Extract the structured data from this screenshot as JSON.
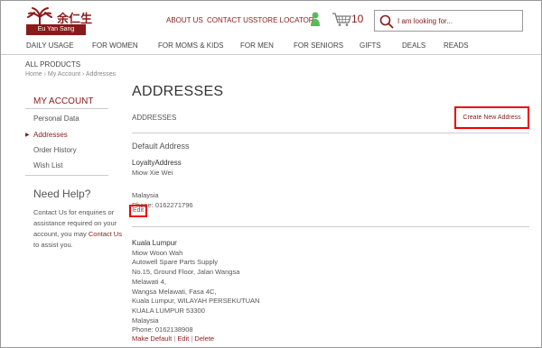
{
  "brand": {
    "chinese_name": "余仁生",
    "english_name": "Eu Yan Sang",
    "accent_color": "#8b1a1a"
  },
  "top_links": [
    "ABOUT US",
    "CONTACT US",
    "STORE LOCATOR"
  ],
  "cart": {
    "count": "10"
  },
  "search": {
    "placeholder": "I am looking for..."
  },
  "nav": [
    "DAILY USAGE",
    "FOR WOMEN",
    "FOR MOMS & KIDS",
    "FOR MEN",
    "FOR SENIORS",
    "GIFTS",
    "DEALS",
    "READS"
  ],
  "all_products": "ALL PRODUCTS",
  "breadcrumb": "Home › My Account › Addresses",
  "sidebar": {
    "title": "MY ACCOUNT",
    "items": [
      "Personal Data",
      "Addresses",
      "Order History",
      "Wish List"
    ],
    "help_title": "Need Help?",
    "help_text": "Contact Us for enquiries or assistance required on your account, you may",
    "help_link": "Contact Us",
    "help_tail": " to assist you."
  },
  "main": {
    "title": "ADDRESSES",
    "section_label": "ADDRESSES",
    "create_button": "Create New Address",
    "default_heading": "Default Address",
    "default_address": {
      "name": "LoyaltyAddress",
      "recipient": "Miow Xie Wei",
      "country": "Malaysia",
      "phone": "Phone: 0162271796",
      "edit": "Edit"
    },
    "second_address": {
      "name": "Kuala Lumpur",
      "lines": [
        "Miow Woon Wah",
        "Autowell Spare Parts Supply",
        "No.15, Ground Floor, Jalan Wangsa",
        "Melawati 4,",
        "Wangsa Melawati, Fasa 4C,",
        "Kuala Lumpur, WILAYAH PERSEKUTUAN",
        "KUALA LUMPUR 53300",
        "Malaysia",
        "Phone: 0162138908"
      ],
      "actions": [
        "Make Default",
        "Edit",
        "Delete"
      ]
    }
  }
}
